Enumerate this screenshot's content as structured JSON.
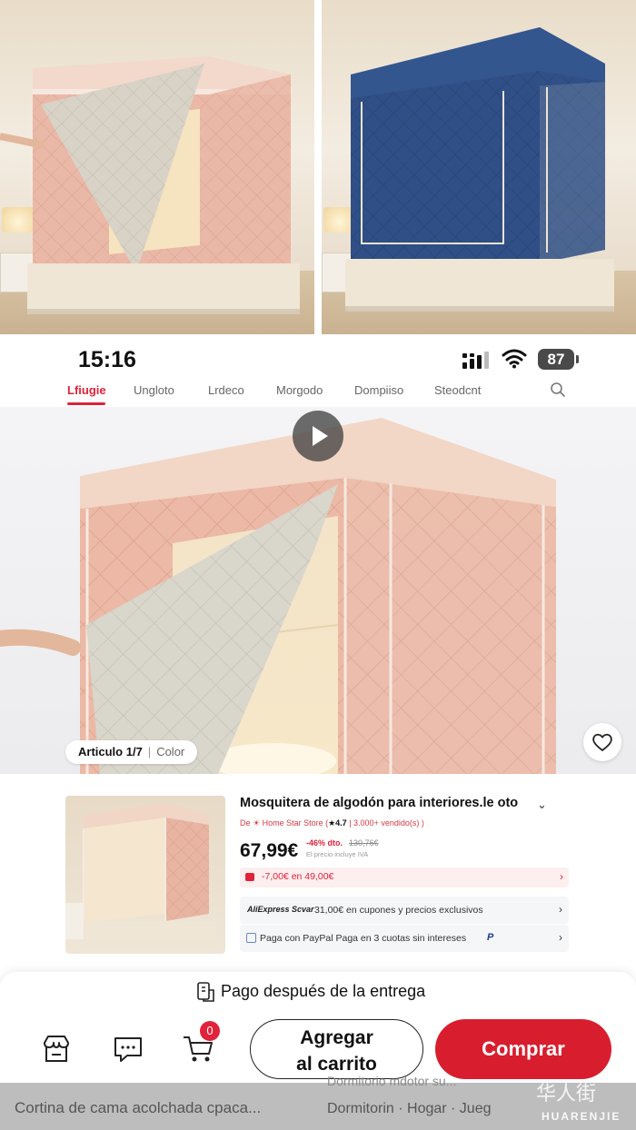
{
  "status_bar": {
    "time": "15:16",
    "battery": "87"
  },
  "tabs": [
    {
      "label": "Lfiugie",
      "active": true
    },
    {
      "label": "Ungloto",
      "active": false
    },
    {
      "label": "Lrdeco",
      "active": false
    },
    {
      "label": "Morgodo",
      "active": false
    },
    {
      "label": "Dompiiso",
      "active": false
    },
    {
      "label": "Steodcnt",
      "active": false
    }
  ],
  "gallery": {
    "counter": "Articulo 1/7",
    "color_label": "Color"
  },
  "product": {
    "title": "Mosquitera de algodón para interiores.le oto",
    "store_prefix": "De ☀ Home Star Store (",
    "rating": "★4.7",
    "sold": " | 3.000+ vendido(s) )",
    "price": "67,99€",
    "discount": "-46% dto.",
    "old_price": "130,76€",
    "tax_note": "El precio incluye IVA",
    "coupon": "-7,00€ en 49,00€",
    "promo_brand": "AliExpress Scvar",
    "promo_text": "31,00€ en cupones y precios exclusivos",
    "paypal_text": "Paga con PayPal Paga en 3 cuotas sin intereses"
  },
  "bottom_bar": {
    "cod_text": "Pago después de la entrega",
    "cart_count": "0",
    "add_to_cart_line1": "Agregar",
    "add_to_cart_line2": "al carrito",
    "buy": "Comprar"
  },
  "recommendations": {
    "item1": "Cortina de cama acolchada cpaca...",
    "item2": "Dormitorin · Hogar · Jueg",
    "item2_ghost": "Dormitorio mdotor su..."
  },
  "watermark": {
    "cn": "华人街",
    "en": "HUARENJIE"
  },
  "colors": {
    "accent": "#e0223a",
    "buy": "#d81e2e",
    "canopy_pink": "#eab8a7",
    "canopy_blue": "#2f4f86"
  }
}
